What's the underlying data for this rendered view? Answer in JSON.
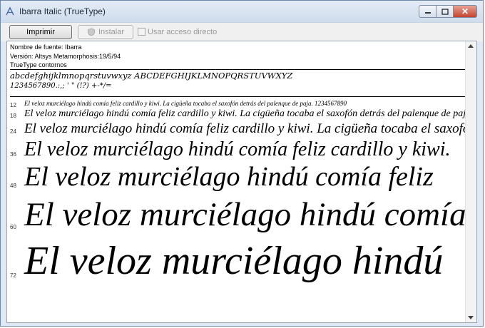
{
  "window": {
    "title": "Ibarra Italic (TrueType)",
    "close_glyph": "✕"
  },
  "toolbar": {
    "print_label": "Imprimir",
    "install_label": "Instalar",
    "shortcut_label": "Usar acceso directo"
  },
  "info": {
    "font_name": "Nombre de fuente: Ibarra",
    "version": "Versión: Altsys Metamorphosis:19/5/94",
    "type": "TrueType  contornos"
  },
  "alphabet": {
    "line1": "abcdefghijklmnopqrstuvwxyz ABCDEFGHIJKLMNOPQRSTUVWXYZ",
    "line2": "1234567890.:,; ' \" (!?) +-*/="
  },
  "samples": [
    {
      "size": "12",
      "text": "El veloz murciélago hindú comía feliz cardillo y kiwi. La cigüeña tocaba el saxofón detrás del palenque de paja. 1234567890"
    },
    {
      "size": "18",
      "text": "El veloz murciélago hindú comía feliz cardillo y kiwi. La cigüeña tocaba el saxofón detrás del palenque de paja."
    },
    {
      "size": "24",
      "text": "El veloz murciélago hindú comía feliz cardillo y kiwi. La cigüeña tocaba el saxofón"
    },
    {
      "size": "36",
      "text": "El veloz murciélago hindú comía feliz cardillo y kiwi."
    },
    {
      "size": "48",
      "text": "El veloz murciélago hindú comía feliz"
    },
    {
      "size": "60",
      "text": "El veloz murciélago hindú comía"
    },
    {
      "size": "72",
      "text": "El veloz murciélago hindú"
    }
  ]
}
